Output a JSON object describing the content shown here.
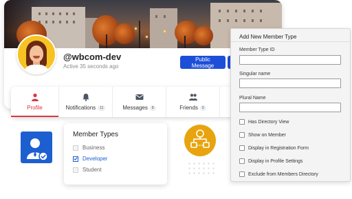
{
  "profile": {
    "username": "@wbcom-dev",
    "last_active": "Active 35 seconds ago",
    "public_message_label": "Public Message"
  },
  "tabs": [
    {
      "label": "Profile",
      "count": "",
      "icon": "person-icon",
      "active": true
    },
    {
      "label": "Notifications",
      "count": "11",
      "icon": "bell-icon",
      "active": false
    },
    {
      "label": "Messages",
      "count": "8",
      "icon": "envelope-icon",
      "active": false
    },
    {
      "label": "Friends",
      "count": "5",
      "icon": "users-icon",
      "active": false
    }
  ],
  "member_types": {
    "title": "Member Types",
    "options": [
      {
        "label": "Business",
        "checked": false
      },
      {
        "label": "Developer",
        "checked": true
      },
      {
        "label": "Student",
        "checked": false
      }
    ]
  },
  "panel": {
    "title": "Add New Member Type",
    "fields": [
      {
        "label": "Member Type ID",
        "value": ""
      },
      {
        "label": "Singular name",
        "value": ""
      },
      {
        "label": "Plural Name",
        "value": ""
      }
    ],
    "options": [
      {
        "label": "Has Directory View",
        "checked": false
      },
      {
        "label": "Show on Member",
        "checked": false
      },
      {
        "label": "Display in Registration Form",
        "checked": false
      },
      {
        "label": "Display in Profile Settings",
        "checked": false
      },
      {
        "label": "Exclude from Members Directory",
        "checked": false
      }
    ]
  },
  "colors": {
    "accent_blue": "#1d4ed8",
    "active_tab_red": "#d9363e",
    "badge_yellow": "#e8a40f",
    "avatar_bg": "#f7c323"
  }
}
